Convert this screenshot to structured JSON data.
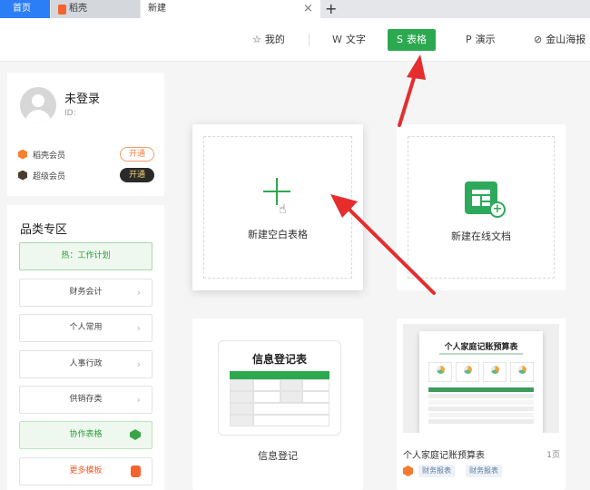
{
  "tabs": {
    "home": "首页",
    "daoke": "稻壳",
    "new": "新建",
    "close": "×",
    "add": "+"
  },
  "nav": {
    "mine": "我的",
    "text": "文字",
    "sheet": "表格",
    "slides": "演示",
    "poster": "金山海报"
  },
  "user": {
    "name": "未登录",
    "id_label": "ID:"
  },
  "members": [
    {
      "name": "稻壳会员",
      "action": "开通"
    },
    {
      "name": "超级会员",
      "action": "开通"
    }
  ],
  "category": {
    "title": "品类专区",
    "items": [
      "热：工作计划",
      "财务会计",
      "个人常用",
      "人事行政",
      "供销存类",
      "协作表格",
      "更多模板"
    ]
  },
  "cards": {
    "blank": "新建空白表格",
    "online": "新建在线文档",
    "info": {
      "label": "信息登记",
      "preview_title": "信息登记表"
    },
    "budget": {
      "label": "个人家庭记账预算表",
      "pages": "1页",
      "preview_title": "个人家庭记账预算表",
      "tags": [
        "财务报表",
        "财务报表"
      ]
    }
  },
  "colors": {
    "green": "#2ca94f",
    "blue_tab": "#2c7ef7",
    "arrow_red": "#e52d2d",
    "orange": "#f4622e"
  },
  "icons": [
    "star-icon",
    "text-doc-icon",
    "sheet-icon",
    "slides-icon",
    "poster-icon",
    "plus-icon",
    "cursor-icon",
    "online-sheet-icon",
    "chevron-right-icon"
  ]
}
